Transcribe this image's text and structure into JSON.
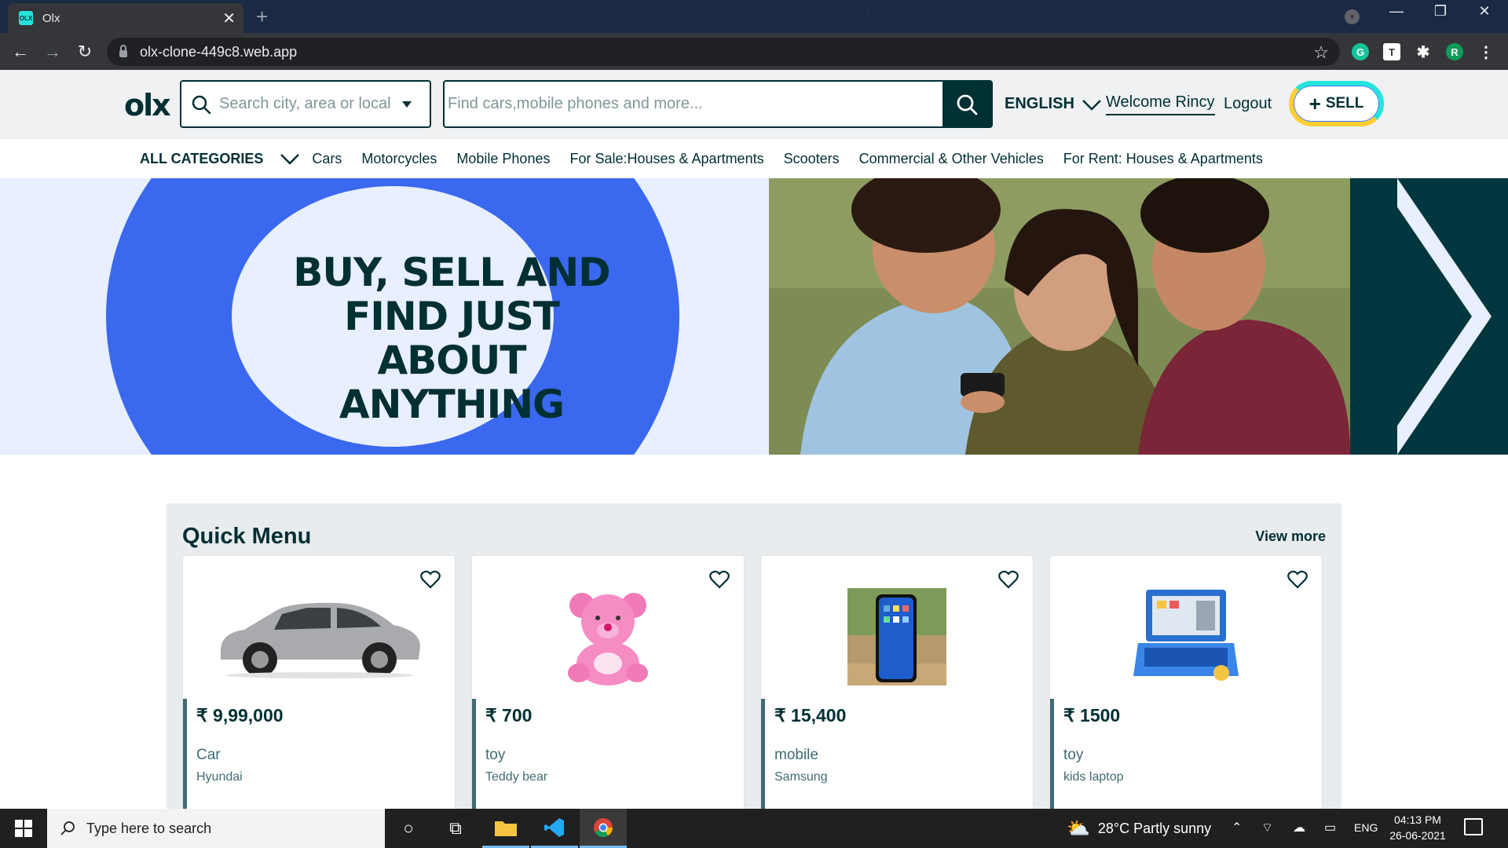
{
  "browser": {
    "tab_title": "Olx",
    "favicon_text": "OLX",
    "url": "olx-clone-449c8.web.app",
    "profile_initial": "R",
    "ext_t_label": "T",
    "ext_r_label": "R"
  },
  "header": {
    "logo": "olx",
    "location_placeholder": "Search city, area or local",
    "search_placeholder": "Find cars,mobile phones and more...",
    "language": "ENGLISH",
    "welcome": "Welcome Rincy",
    "logout": "Logout",
    "sell": "SELL"
  },
  "categories": {
    "all_label": "ALL CATEGORIES",
    "items": [
      "Cars",
      "Motorcycles",
      "Mobile Phones",
      "For Sale:Houses & Apartments",
      "Scooters",
      "Commercial & Other Vehicles",
      "For Rent: Houses & Apartments"
    ]
  },
  "banner": {
    "headline_1": "BUY, SELL AND",
    "headline_2": "FIND JUST ABOUT",
    "headline_3": "ANYTHING"
  },
  "quick_menu": {
    "title": "Quick Menu",
    "view_more": "View more",
    "cards": [
      {
        "price": "₹ 9,99,000",
        "category": "Car",
        "name": "Hyundai",
        "image_icon": "car-image"
      },
      {
        "price": "₹ 700",
        "category": "toy",
        "name": "Teddy bear",
        "image_icon": "teddy-bear-image"
      },
      {
        "price": "₹ 15,400",
        "category": "mobile",
        "name": "Samsung",
        "image_icon": "phone-image"
      },
      {
        "price": "₹ 1500",
        "category": "toy",
        "name": "kids laptop",
        "image_icon": "kids-laptop-image"
      }
    ]
  },
  "taskbar": {
    "search_placeholder": "Type here to search",
    "weather": "28°C  Partly sunny",
    "language": "ENG",
    "time": "04:13 PM",
    "date": "26-06-2021"
  },
  "colors": {
    "olx_dark": "#002f34",
    "olx_teal": "#23e5db",
    "olx_yellow": "#ffce32",
    "olx_blue": "#3a68ee"
  }
}
